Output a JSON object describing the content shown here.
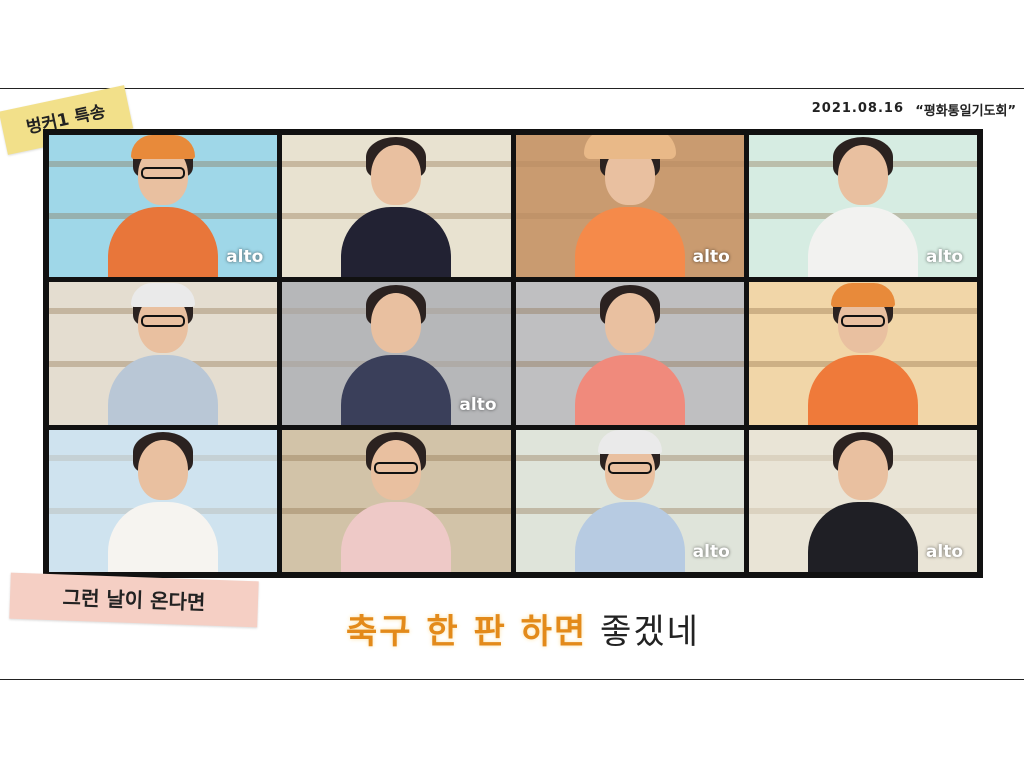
{
  "header": {
    "special_tag": "벙커1 특송",
    "date": "2021.08.16",
    "event": "“평화통일기도회”"
  },
  "tiles": [
    {
      "bg": "#9fd7e8",
      "shirt": "#e8763a",
      "accessory": "cap",
      "label": "alto"
    },
    {
      "bg": "#e8e2d0",
      "shirt": "#222233",
      "accessory": "none",
      "label": ""
    },
    {
      "bg": "#c99b70",
      "shirt": "#f58a4a",
      "accessory": "hat",
      "label": "alto"
    },
    {
      "bg": "#d6ece2",
      "shirt": "#f2f2f0",
      "accessory": "none",
      "label": "alto"
    },
    {
      "bg": "#e4ddd0",
      "shirt": "#b9c7d6",
      "accessory": "cap-glasses",
      "label": ""
    },
    {
      "bg": "#b6b7b9",
      "shirt": "#3a3f5a",
      "accessory": "none",
      "label": "alto"
    },
    {
      "bg": "#bfbfc1",
      "shirt": "#f08a7c",
      "accessory": "none",
      "label": ""
    },
    {
      "bg": "#f1d6a8",
      "shirt": "#ef7a3a",
      "accessory": "cap-glasses",
      "label": ""
    },
    {
      "bg": "#cfe3ef",
      "shirt": "#f6f4f0",
      "accessory": "none",
      "label": ""
    },
    {
      "bg": "#d2c3a8",
      "shirt": "#eec9c7",
      "accessory": "glasses",
      "label": ""
    },
    {
      "bg": "#dfe4da",
      "shirt": "#b7cbe2",
      "accessory": "cap-glasses",
      "label": "alto"
    },
    {
      "bg": "#e9e4d6",
      "shirt": "#1f1f25",
      "accessory": "none",
      "label": "alto"
    }
  ],
  "song_tag": "그런 날이 온다면",
  "lyric": {
    "highlight": "축구 한 판 하면",
    "rest": " 좋겠네"
  },
  "colors": {
    "highlight": "#e38a1a",
    "tag_yellow": "#f2e08a",
    "tag_pink": "#f5cfc4"
  }
}
